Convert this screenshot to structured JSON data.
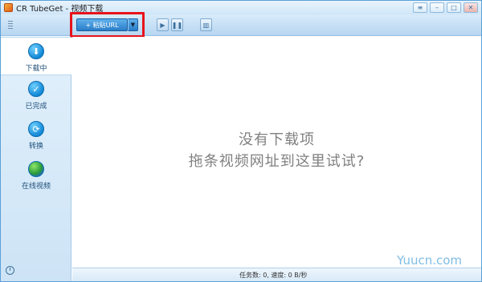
{
  "window": {
    "title": "CR TubeGet - 视频下载"
  },
  "toolbar": {
    "paste_url_label": "+ 粘贴URL"
  },
  "sidebar": {
    "items": [
      {
        "label": "下载中",
        "icon": "download-icon"
      },
      {
        "label": "已完成",
        "icon": "check-icon"
      },
      {
        "label": "转换",
        "icon": "convert-icon"
      },
      {
        "label": "在线视频",
        "icon": "globe-icon"
      }
    ]
  },
  "main": {
    "empty_line1": "没有下载项",
    "empty_line2": "拖条视频网址到这里试试?"
  },
  "status": {
    "text": "任务数: 0, 速度: 0 B/秒"
  },
  "watermark": {
    "text": "Yuucn.com"
  },
  "colors": {
    "accent": "#2a7dc8",
    "highlight": "#e8121b",
    "sidebar_bg": "#cde4f6"
  }
}
